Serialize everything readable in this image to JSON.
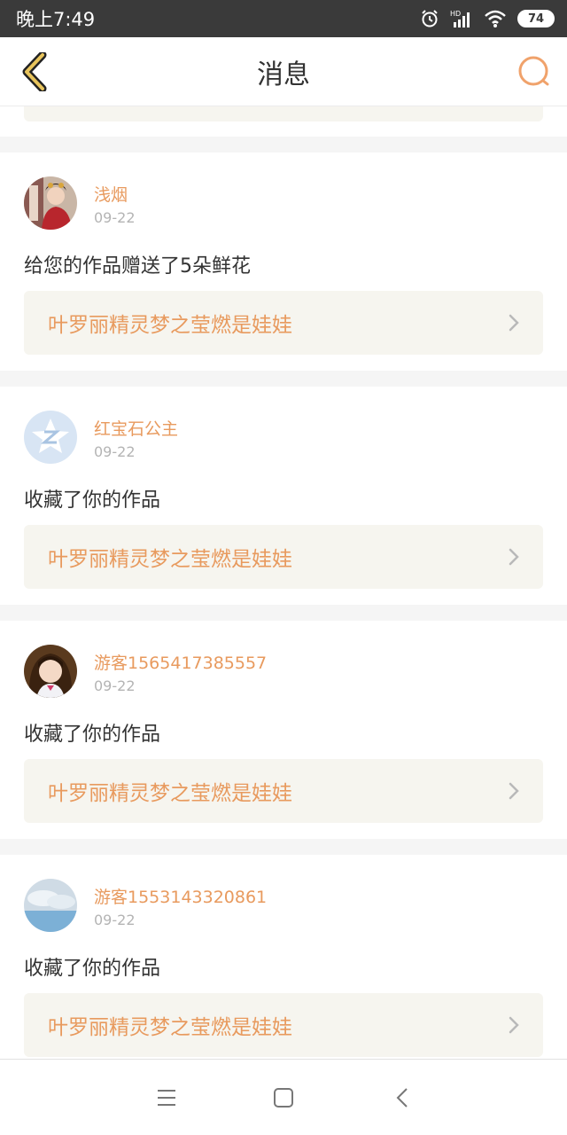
{
  "status_bar": {
    "time": "晚上7:49",
    "battery": "74"
  },
  "header": {
    "title": "消息"
  },
  "colors": {
    "accent": "#e89a5e",
    "link_bg": "#f6f5ef",
    "divider": "#f5f5f5"
  },
  "messages": [
    {
      "username": "浅烟",
      "date": "09-22",
      "action": "给您的作品赠送了5朵鲜花",
      "work_title": "叶罗丽精灵梦之莹燃是娃娃",
      "avatar_icon": "portrait-avatar"
    },
    {
      "username": "红宝石公主",
      "date": "09-22",
      "action": "收藏了你的作品",
      "work_title": "叶罗丽精灵梦之莹燃是娃娃",
      "avatar_icon": "default-z-avatar"
    },
    {
      "username": "游客1565417385557",
      "date": "09-22",
      "action": "收藏了你的作品",
      "work_title": "叶罗丽精灵梦之莹燃是娃娃",
      "avatar_icon": "girl-avatar"
    },
    {
      "username": "游客1553143320861",
      "date": "09-22",
      "action": "收藏了你的作品",
      "work_title": "叶罗丽精灵梦之莹燃是娃娃",
      "avatar_icon": "sky-avatar"
    }
  ]
}
